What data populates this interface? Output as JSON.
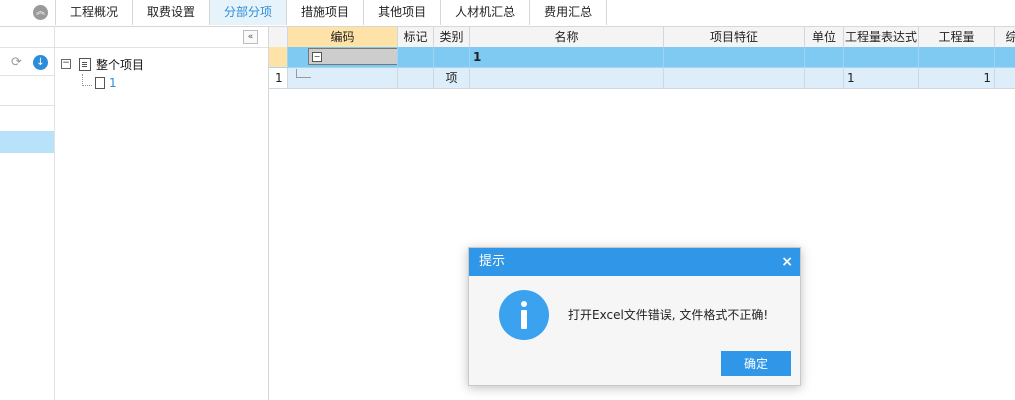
{
  "tabs": [
    {
      "label": "工程概况",
      "active": false
    },
    {
      "label": "取费设置",
      "active": false
    },
    {
      "label": "分部分项",
      "active": true
    },
    {
      "label": "措施项目",
      "active": false
    },
    {
      "label": "其他项目",
      "active": false
    },
    {
      "label": "人材机汇总",
      "active": false
    },
    {
      "label": "费用汇总",
      "active": false
    }
  ],
  "tree": {
    "root_label": "整个项目",
    "child_label": "1"
  },
  "grid": {
    "columns": [
      {
        "key": "rownum",
        "label": ""
      },
      {
        "key": "code",
        "label": "编码"
      },
      {
        "key": "mark",
        "label": "标记"
      },
      {
        "key": "type",
        "label": "类别"
      },
      {
        "key": "name",
        "label": "名称"
      },
      {
        "key": "feature",
        "label": "项目特征"
      },
      {
        "key": "unit",
        "label": "单位"
      },
      {
        "key": "qty_expr",
        "label": "工程量表达式"
      },
      {
        "key": "qty",
        "label": "工程量"
      },
      {
        "key": "extra",
        "label": "综"
      }
    ],
    "rows": [
      {
        "rownum": "",
        "code": "",
        "mark": "",
        "type": "",
        "name": "1",
        "feature": "",
        "unit": "",
        "qty_expr": "",
        "qty": "",
        "extra": ""
      },
      {
        "rownum": "1",
        "code": "",
        "mark": "",
        "type": "项",
        "name": "",
        "feature": "",
        "unit": "",
        "qty_expr": "1",
        "qty": "1",
        "extra": ""
      }
    ]
  },
  "dialog": {
    "title": "提示",
    "close_glyph": "×",
    "message": "打开Excel文件错误, 文件格式不正确!",
    "ok_label": "确定"
  },
  "colors": {
    "accent": "#2f96e8",
    "selected_row": "#7fcaf2",
    "header_highlight": "#ffe2a8"
  }
}
